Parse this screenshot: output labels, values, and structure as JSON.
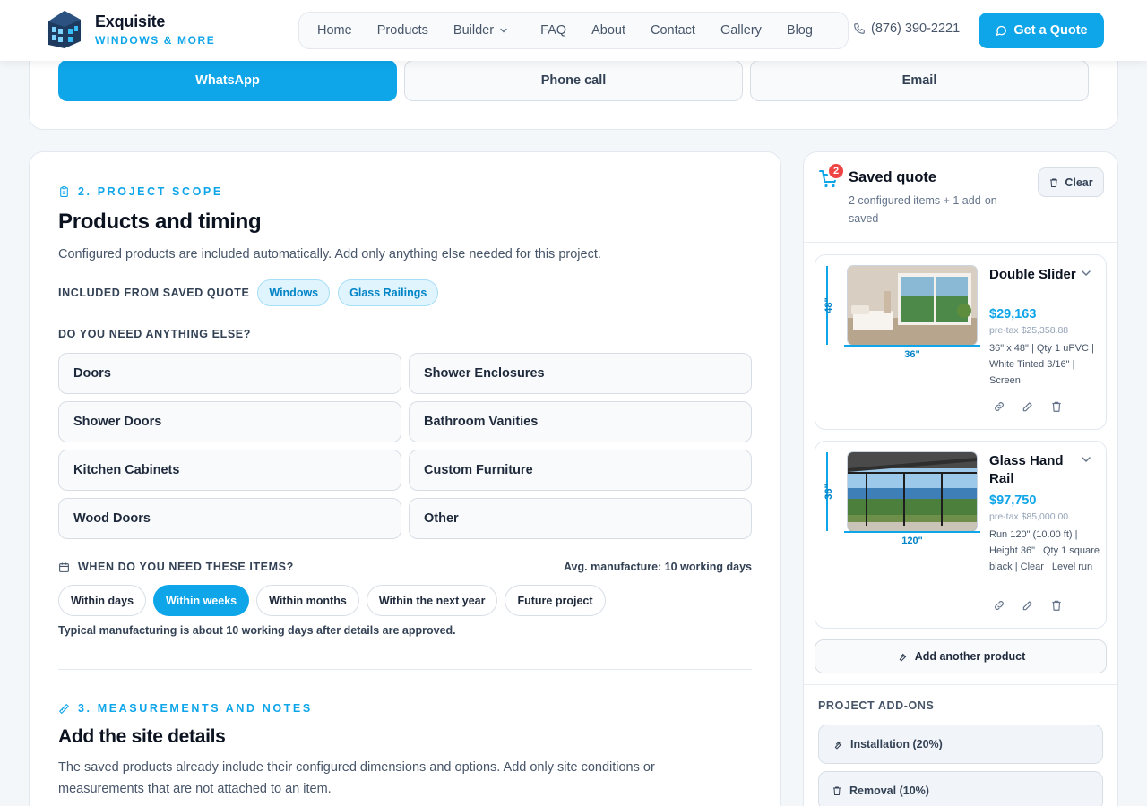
{
  "header": {
    "brand": "Exquisite",
    "brand_sub": "WINDOWS & MORE",
    "nav": [
      {
        "label": "Home"
      },
      {
        "label": "Products"
      },
      {
        "label": "Builder"
      },
      {
        "label": "FAQ"
      },
      {
        "label": "About"
      },
      {
        "label": "Contact"
      },
      {
        "label": "Gallery"
      },
      {
        "label": "Blog"
      }
    ],
    "phone": "(876) 390-2221",
    "cta": "Get a Quote"
  },
  "contact_methods": [
    {
      "label": "WhatsApp",
      "selected": true
    },
    {
      "label": "Phone call",
      "selected": false
    },
    {
      "label": "Email",
      "selected": false
    }
  ],
  "scope": {
    "label": "2. PROJECT SCOPE",
    "title": "Products and timing",
    "description": "Configured products are included automatically. Add only anything else needed for this project.",
    "included_label": "INCLUDED FROM SAVED QUOTE",
    "included": [
      "Windows",
      "Glass Railings"
    ],
    "need_label": "DO YOU NEED ANYTHING ELSE?",
    "options": [
      "Doors",
      "Shower Enclosures",
      "Shower Doors",
      "Bathroom Vanities",
      "Kitchen Cabinets",
      "Custom Furniture",
      "Wood Doors",
      "Other"
    ],
    "when_label": "WHEN DO YOU NEED THESE ITEMS?",
    "avg_manufacture": "Avg. manufacture: 10 working days",
    "timing": [
      "Within days",
      "Within weeks",
      "Within months",
      "Within the next year",
      "Future project"
    ],
    "timing_selected": "Within weeks",
    "typical_note": "Typical manufacturing is about 10 working days after details are approved."
  },
  "measurements": {
    "label": "3. MEASUREMENTS AND NOTES",
    "title": "Add the site details",
    "description": "The saved products already include their configured dimensions and options. Add only site conditions or measurements that are not attached to an item."
  },
  "saved_quote": {
    "count": "2",
    "title": "Saved quote",
    "subtitle": "2 configured items + 1 add-on saved",
    "clear_label": "Clear",
    "items": [
      {
        "name": "Double Slider",
        "price": "$29,163",
        "pretax": "pre-tax $25,358.88",
        "specs": "36\" x 48\" | Qty 1 uPVC | White Tinted 3/16\" | Screen",
        "height_label": "48\"",
        "width_label": "36\""
      },
      {
        "name": "Glass Hand Rail",
        "price": "$97,750",
        "pretax": "pre-tax $85,000.00",
        "specs": "Run 120\" (10.00 ft) | Height 36\" | Qty 1 square black | Clear | Level run",
        "height_label": "36\"",
        "width_label": "120\""
      }
    ],
    "add_product": "Add another product",
    "addons_label": "PROJECT ADD-ONS",
    "addons": [
      "Installation (20%)",
      "Removal (10%)"
    ]
  },
  "colors": {
    "accent": "#0ea5e9",
    "badge": "#ef4444"
  }
}
